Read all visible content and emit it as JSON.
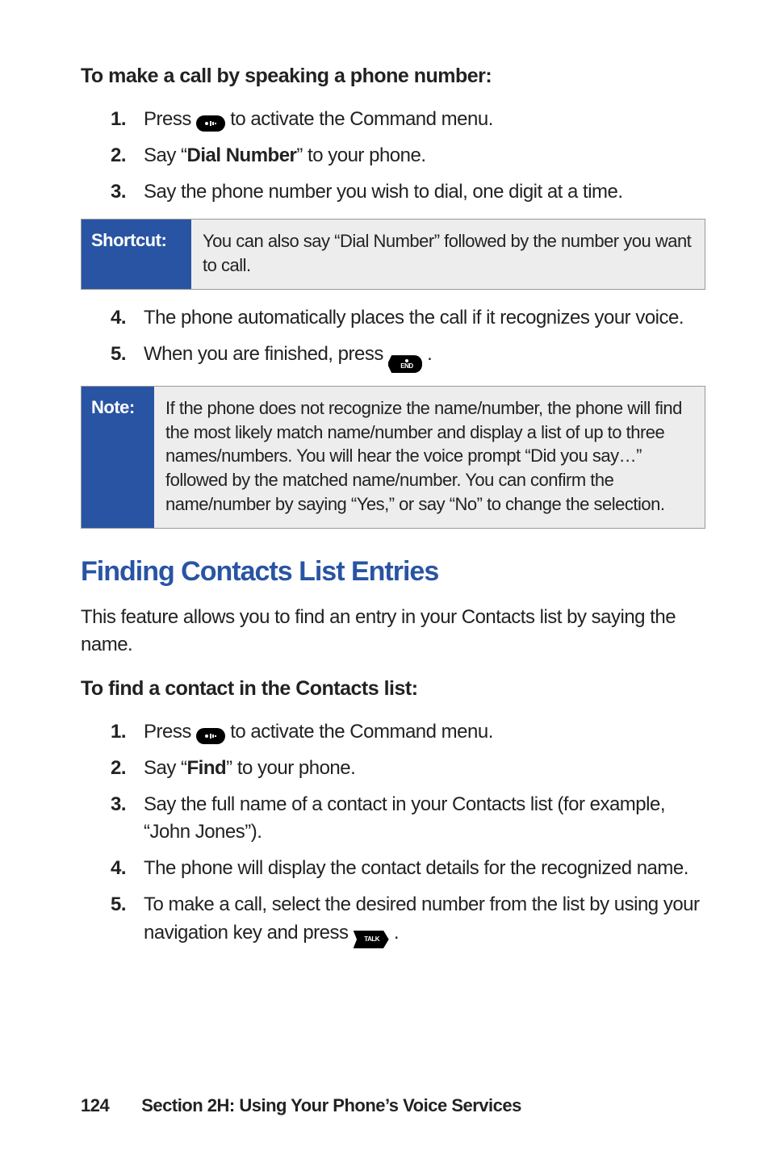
{
  "headings": {
    "make_call": "To make a call by speaking a phone number:",
    "finding_title": "Finding Contacts List Entries",
    "finding_intro": "This feature allows you to find an entry in your Contacts list by saying the name.",
    "find_sub": "To find a contact in the Contacts list:"
  },
  "steps_make": {
    "s1a": "Press ",
    "s1b": " to activate the Command menu.",
    "s2a": "Say “",
    "s2_bold": "Dial Number",
    "s2b": "” to your phone.",
    "s3": "Say the phone number you wish to dial, one digit at a time.",
    "s4": "The phone automatically places the call if it recognizes your voice.",
    "s5a": "When you are finished, press ",
    "s5b": "."
  },
  "steps_find": {
    "s1a": "Press ",
    "s1b": " to activate the Command menu.",
    "s2a": "Say “",
    "s2_bold": "Find",
    "s2b": "” to your phone.",
    "s3": "Say the full name of a contact in your Contacts list (for example, “John Jones”).",
    "s4": "The phone will display the contact details for the recognized name.",
    "s5a": "To make a call, select the desired number from the list by using your navigation key and press ",
    "s5b": "."
  },
  "callouts": {
    "shortcut_label": "Shortcut:",
    "shortcut_body": "You can also say “Dial Number” followed by the number you want to call.",
    "note_label": "Note:",
    "note_body": "If the phone does not recognize the name/number, the phone will find the most likely match name/number and display a list of up to three names/numbers. You will hear the voice prompt “Did you say…” followed by the matched name/number. You can confirm the name/number by saying “Yes,” or say “No” to change the selection."
  },
  "nums": {
    "n1": "1.",
    "n2": "2.",
    "n3": "3.",
    "n4": "4.",
    "n5": "5."
  },
  "footer": {
    "page": "124",
    "section": "Section 2H: Using Your Phone’s Voice Services"
  },
  "icons": {
    "voice_key": "voice-key-icon",
    "end_key_label": "END",
    "talk_key_label": "TALK"
  }
}
